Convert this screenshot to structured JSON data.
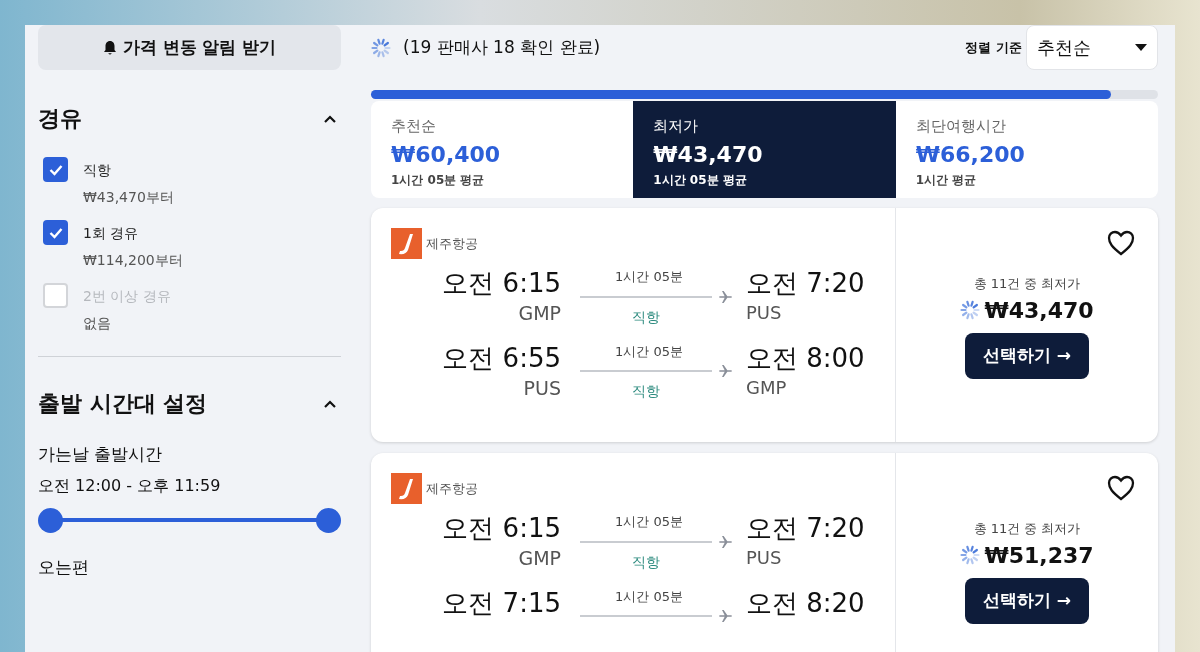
{
  "alert_button": {
    "label": "가격 변동 알림 받기"
  },
  "status": {
    "text": "(19 판매사 18 확인 완료)"
  },
  "sort": {
    "label": "정렬 기준",
    "value": "추천순"
  },
  "progress": {
    "level": 0.94
  },
  "stops_filter": {
    "title": "경유",
    "expanded": true,
    "options": [
      {
        "label": "직항",
        "sub": "₩43,470부터",
        "checked": true,
        "disabled": false
      },
      {
        "label": "1회 경유",
        "sub": "₩114,200부터",
        "checked": true,
        "disabled": false
      },
      {
        "label": "2번 이상 경유",
        "sub": "없음",
        "checked": false,
        "disabled": true
      }
    ]
  },
  "time_filter": {
    "title": "출발 시간대 설정",
    "expanded": true,
    "ranges": [
      {
        "label": "가는날 출발시간",
        "value": "오전 12:00 - 오후 11:59",
        "level": 1
      },
      {
        "label": "오는편"
      }
    ]
  },
  "sort_tabs": [
    {
      "label": "추천순",
      "price": "₩60,400",
      "duration": "1시간 05분 평균",
      "selected": false
    },
    {
      "label": "최저가",
      "price": "₩43,470",
      "duration": "1시간 05분 평균",
      "selected": true
    },
    {
      "label": "최단여행시간",
      "price": "₩66,200",
      "duration": "1시간 평균",
      "selected": false
    }
  ],
  "flights": [
    {
      "airline": "제주항공",
      "favorite": false,
      "price_note": "총 11건 중 최저가",
      "price": "₩43,470",
      "button": "선택하기 →",
      "legs": [
        {
          "depart_time": "오전 6:15",
          "depart_code": "GMP",
          "duration": "1시간 05분",
          "stops": "직항",
          "arrive_time": "오전 7:20",
          "arrive_code": "PUS"
        },
        {
          "depart_time": "오전 6:55",
          "depart_code": "PUS",
          "duration": "1시간 05분",
          "stops": "직항",
          "arrive_time": "오전 8:00",
          "arrive_code": "GMP"
        }
      ]
    },
    {
      "airline": "제주항공",
      "favorite": false,
      "price_note": "총 11건 중 최저가",
      "price": "₩51,237",
      "button": "선택하기 →",
      "legs": [
        {
          "depart_time": "오전 6:15",
          "depart_code": "GMP",
          "duration": "1시간 05분",
          "stops": "직항",
          "arrive_time": "오전 7:20",
          "arrive_code": "PUS"
        },
        {
          "depart_time": "오전 7:15",
          "duration": "1시간 05분",
          "arrive_time": "오전 8:20"
        }
      ]
    }
  ]
}
